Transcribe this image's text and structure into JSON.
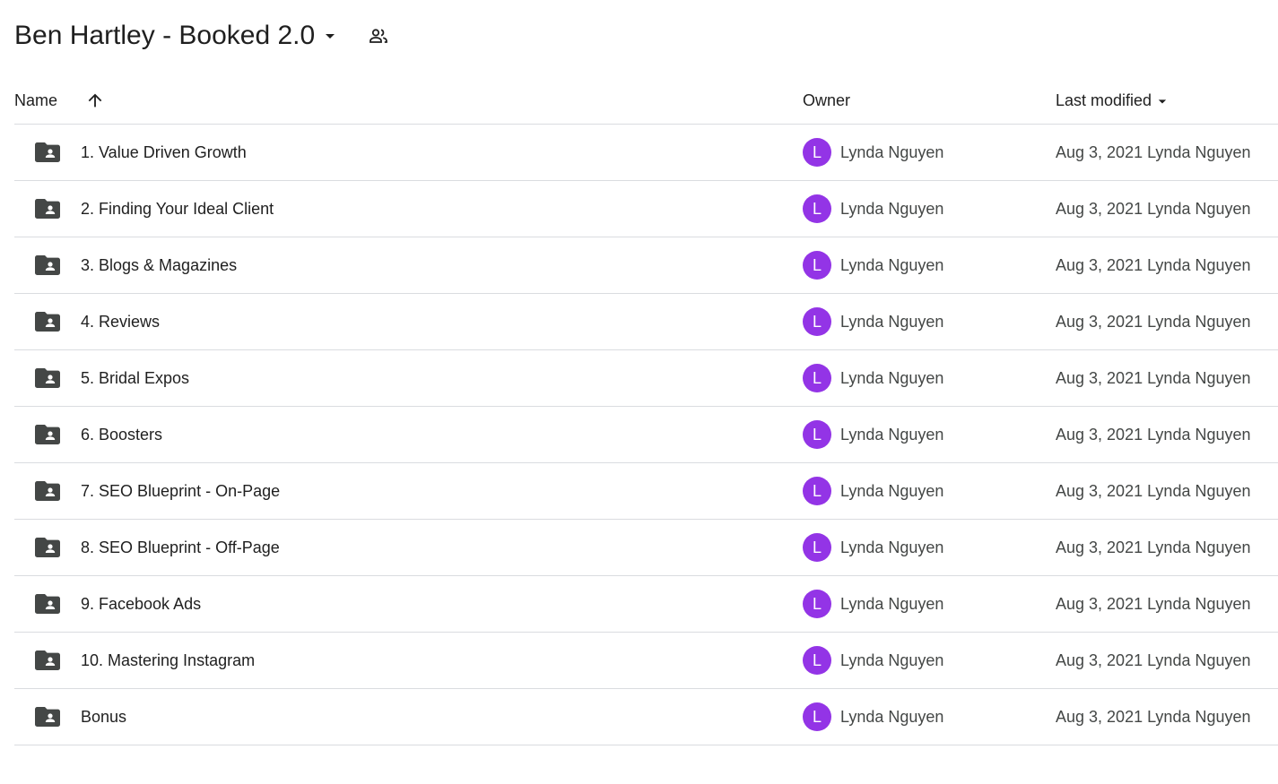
{
  "header": {
    "title": "Ben Hartley - Booked 2.0",
    "dropdown_icon": "arrow-drop-down-icon",
    "share_icon": "people-icon"
  },
  "columns": {
    "name": "Name",
    "name_sort_icon": "arrow-upward-icon",
    "owner": "Owner",
    "last_modified": "Last modified",
    "last_modified_icon": "arrow-drop-down-icon"
  },
  "colors": {
    "avatar_bg": "#9334e6",
    "folder_icon": "#444746",
    "divider": "#dadce0"
  },
  "files": [
    {
      "name": "1. Value Driven Growth",
      "avatar": "L",
      "owner": "Lynda Nguyen",
      "modified": "Aug 3, 2021 Lynda Nguyen",
      "icon": "shared-folder-icon"
    },
    {
      "name": "2. Finding Your Ideal Client",
      "avatar": "L",
      "owner": "Lynda Nguyen",
      "modified": "Aug 3, 2021 Lynda Nguyen",
      "icon": "shared-folder-icon"
    },
    {
      "name": "3. Blogs & Magazines",
      "avatar": "L",
      "owner": "Lynda Nguyen",
      "modified": "Aug 3, 2021 Lynda Nguyen",
      "icon": "shared-folder-icon"
    },
    {
      "name": "4. Reviews",
      "avatar": "L",
      "owner": "Lynda Nguyen",
      "modified": "Aug 3, 2021 Lynda Nguyen",
      "icon": "shared-folder-icon"
    },
    {
      "name": "5. Bridal Expos",
      "avatar": "L",
      "owner": "Lynda Nguyen",
      "modified": "Aug 3, 2021 Lynda Nguyen",
      "icon": "shared-folder-icon"
    },
    {
      "name": "6. Boosters",
      "avatar": "L",
      "owner": "Lynda Nguyen",
      "modified": "Aug 3, 2021 Lynda Nguyen",
      "icon": "shared-folder-icon"
    },
    {
      "name": "7. SEO Blueprint - On-Page",
      "avatar": "L",
      "owner": "Lynda Nguyen",
      "modified": "Aug 3, 2021 Lynda Nguyen",
      "icon": "shared-folder-icon"
    },
    {
      "name": "8. SEO Blueprint - Off-Page",
      "avatar": "L",
      "owner": "Lynda Nguyen",
      "modified": "Aug 3, 2021 Lynda Nguyen",
      "icon": "shared-folder-icon"
    },
    {
      "name": "9. Facebook Ads",
      "avatar": "L",
      "owner": "Lynda Nguyen",
      "modified": "Aug 3, 2021 Lynda Nguyen",
      "icon": "shared-folder-icon"
    },
    {
      "name": "10. Mastering Instagram",
      "avatar": "L",
      "owner": "Lynda Nguyen",
      "modified": "Aug 3, 2021 Lynda Nguyen",
      "icon": "shared-folder-icon"
    },
    {
      "name": "Bonus",
      "avatar": "L",
      "owner": "Lynda Nguyen",
      "modified": "Aug 3, 2021 Lynda Nguyen",
      "icon": "shared-folder-icon"
    }
  ]
}
